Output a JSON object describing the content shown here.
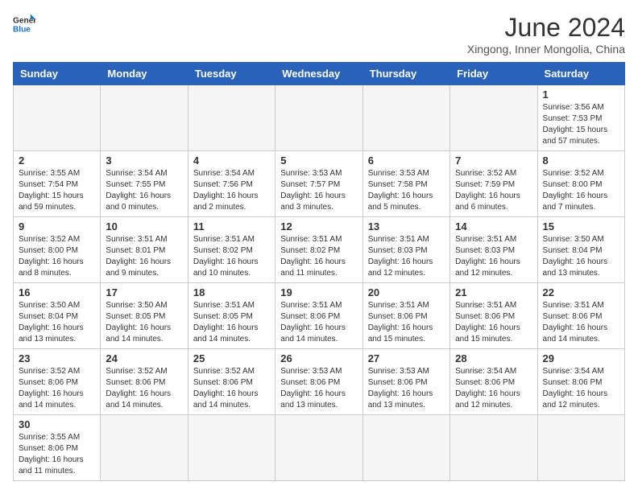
{
  "header": {
    "logo_general": "General",
    "logo_blue": "Blue",
    "month_title": "June 2024",
    "location": "Xingong, Inner Mongolia, China"
  },
  "weekdays": [
    "Sunday",
    "Monday",
    "Tuesday",
    "Wednesday",
    "Thursday",
    "Friday",
    "Saturday"
  ],
  "weeks": [
    [
      {
        "day": "",
        "info": ""
      },
      {
        "day": "",
        "info": ""
      },
      {
        "day": "",
        "info": ""
      },
      {
        "day": "",
        "info": ""
      },
      {
        "day": "",
        "info": ""
      },
      {
        "day": "",
        "info": ""
      },
      {
        "day": "1",
        "info": "Sunrise: 3:56 AM\nSunset: 7:53 PM\nDaylight: 15 hours\nand 57 minutes."
      }
    ],
    [
      {
        "day": "2",
        "info": "Sunrise: 3:55 AM\nSunset: 7:54 PM\nDaylight: 15 hours\nand 59 minutes."
      },
      {
        "day": "3",
        "info": "Sunrise: 3:54 AM\nSunset: 7:55 PM\nDaylight: 16 hours\nand 0 minutes."
      },
      {
        "day": "4",
        "info": "Sunrise: 3:54 AM\nSunset: 7:56 PM\nDaylight: 16 hours\nand 2 minutes."
      },
      {
        "day": "5",
        "info": "Sunrise: 3:53 AM\nSunset: 7:57 PM\nDaylight: 16 hours\nand 3 minutes."
      },
      {
        "day": "6",
        "info": "Sunrise: 3:53 AM\nSunset: 7:58 PM\nDaylight: 16 hours\nand 5 minutes."
      },
      {
        "day": "7",
        "info": "Sunrise: 3:52 AM\nSunset: 7:59 PM\nDaylight: 16 hours\nand 6 minutes."
      },
      {
        "day": "8",
        "info": "Sunrise: 3:52 AM\nSunset: 8:00 PM\nDaylight: 16 hours\nand 7 minutes."
      }
    ],
    [
      {
        "day": "9",
        "info": "Sunrise: 3:52 AM\nSunset: 8:00 PM\nDaylight: 16 hours\nand 8 minutes."
      },
      {
        "day": "10",
        "info": "Sunrise: 3:51 AM\nSunset: 8:01 PM\nDaylight: 16 hours\nand 9 minutes."
      },
      {
        "day": "11",
        "info": "Sunrise: 3:51 AM\nSunset: 8:02 PM\nDaylight: 16 hours\nand 10 minutes."
      },
      {
        "day": "12",
        "info": "Sunrise: 3:51 AM\nSunset: 8:02 PM\nDaylight: 16 hours\nand 11 minutes."
      },
      {
        "day": "13",
        "info": "Sunrise: 3:51 AM\nSunset: 8:03 PM\nDaylight: 16 hours\nand 12 minutes."
      },
      {
        "day": "14",
        "info": "Sunrise: 3:51 AM\nSunset: 8:03 PM\nDaylight: 16 hours\nand 12 minutes."
      },
      {
        "day": "15",
        "info": "Sunrise: 3:50 AM\nSunset: 8:04 PM\nDaylight: 16 hours\nand 13 minutes."
      }
    ],
    [
      {
        "day": "16",
        "info": "Sunrise: 3:50 AM\nSunset: 8:04 PM\nDaylight: 16 hours\nand 13 minutes."
      },
      {
        "day": "17",
        "info": "Sunrise: 3:50 AM\nSunset: 8:05 PM\nDaylight: 16 hours\nand 14 minutes."
      },
      {
        "day": "18",
        "info": "Sunrise: 3:51 AM\nSunset: 8:05 PM\nDaylight: 16 hours\nand 14 minutes."
      },
      {
        "day": "19",
        "info": "Sunrise: 3:51 AM\nSunset: 8:06 PM\nDaylight: 16 hours\nand 14 minutes."
      },
      {
        "day": "20",
        "info": "Sunrise: 3:51 AM\nSunset: 8:06 PM\nDaylight: 16 hours\nand 15 minutes."
      },
      {
        "day": "21",
        "info": "Sunrise: 3:51 AM\nSunset: 8:06 PM\nDaylight: 16 hours\nand 15 minutes."
      },
      {
        "day": "22",
        "info": "Sunrise: 3:51 AM\nSunset: 8:06 PM\nDaylight: 16 hours\nand 14 minutes."
      }
    ],
    [
      {
        "day": "23",
        "info": "Sunrise: 3:52 AM\nSunset: 8:06 PM\nDaylight: 16 hours\nand 14 minutes."
      },
      {
        "day": "24",
        "info": "Sunrise: 3:52 AM\nSunset: 8:06 PM\nDaylight: 16 hours\nand 14 minutes."
      },
      {
        "day": "25",
        "info": "Sunrise: 3:52 AM\nSunset: 8:06 PM\nDaylight: 16 hours\nand 14 minutes."
      },
      {
        "day": "26",
        "info": "Sunrise: 3:53 AM\nSunset: 8:06 PM\nDaylight: 16 hours\nand 13 minutes."
      },
      {
        "day": "27",
        "info": "Sunrise: 3:53 AM\nSunset: 8:06 PM\nDaylight: 16 hours\nand 13 minutes."
      },
      {
        "day": "28",
        "info": "Sunrise: 3:54 AM\nSunset: 8:06 PM\nDaylight: 16 hours\nand 12 minutes."
      },
      {
        "day": "29",
        "info": "Sunrise: 3:54 AM\nSunset: 8:06 PM\nDaylight: 16 hours\nand 12 minutes."
      }
    ],
    [
      {
        "day": "30",
        "info": "Sunrise: 3:55 AM\nSunset: 8:06 PM\nDaylight: 16 hours\nand 11 minutes."
      },
      {
        "day": "",
        "info": ""
      },
      {
        "day": "",
        "info": ""
      },
      {
        "day": "",
        "info": ""
      },
      {
        "day": "",
        "info": ""
      },
      {
        "day": "",
        "info": ""
      },
      {
        "day": "",
        "info": ""
      }
    ]
  ]
}
